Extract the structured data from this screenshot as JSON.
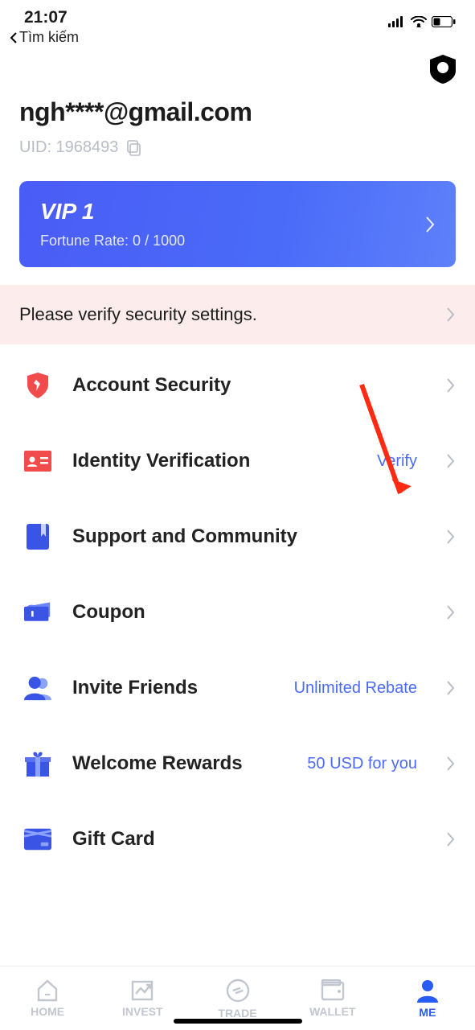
{
  "status": {
    "time": "21:07",
    "back_label": "Tìm kiếm"
  },
  "profile": {
    "email": "ngh****@gmail.com",
    "uid_label": "UID: 1968493"
  },
  "vip": {
    "title": "VIP 1",
    "subtitle": "Fortune Rate: 0 / 1000"
  },
  "alert": {
    "text": "Please verify security settings."
  },
  "menu": [
    {
      "label": "Account Security",
      "right": ""
    },
    {
      "label": "Identity Verification",
      "right": "Verify"
    },
    {
      "label": "Support and Community",
      "right": ""
    },
    {
      "label": "Coupon",
      "right": ""
    },
    {
      "label": "Invite Friends",
      "right": "Unlimited Rebate"
    },
    {
      "label": "Welcome Rewards",
      "right": "50 USD for you"
    },
    {
      "label": "Gift Card",
      "right": ""
    }
  ],
  "tabs": {
    "home": "HOME",
    "invest": "INVEST",
    "trade": "TRADE",
    "wallet": "WALLET",
    "me": "ME"
  }
}
